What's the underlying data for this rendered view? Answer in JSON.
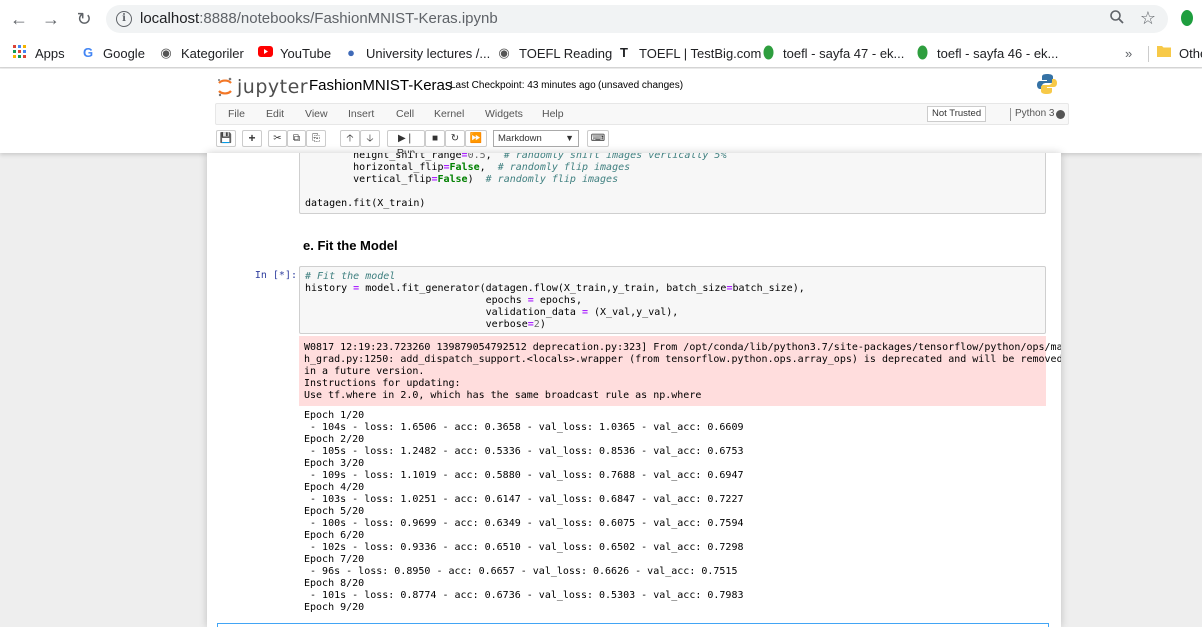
{
  "browser": {
    "url_host": "localhost",
    "url_rest": ":8888/notebooks/FashionMNIST-Keras.ipynb",
    "bookmarks": [
      {
        "label": "Apps",
        "icon": "apps-grid-icon"
      },
      {
        "label": "Google",
        "icon": "google-icon"
      },
      {
        "label": "Kategoriler",
        "icon": "globe-icon"
      },
      {
        "label": "YouTube",
        "icon": "youtube-icon"
      },
      {
        "label": "University lectures /...",
        "icon": "university-icon"
      },
      {
        "label": "TOEFL Reading",
        "icon": "globe-icon"
      },
      {
        "label": "TOEFL | TestBig.com",
        "icon": "t-icon"
      },
      {
        "label": "toefl - sayfa 47 - ek...",
        "icon": "leaf-icon"
      },
      {
        "label": "toefl - sayfa 46 - ek...",
        "icon": "leaf-icon"
      }
    ],
    "bookmarks_more": "»",
    "bookmarks_other": "Othe"
  },
  "jupyter": {
    "logo_text": "jupyter",
    "notebook_name": "FashionMNIST-Keras",
    "checkpoint": "Last Checkpoint: 43 minutes ago",
    "unsaved": "(unsaved changes)",
    "menu": [
      "File",
      "Edit",
      "View",
      "Insert",
      "Cell",
      "Kernel",
      "Widgets",
      "Help"
    ],
    "trust": "Not Trusted",
    "kernel": "Python 3",
    "toolbar": {
      "run_label": "Run",
      "cell_type": "Markdown"
    }
  },
  "cells": {
    "prev_code_lines": [
      "        height_shift_range=0.5,  # randomly shift images vertically 5%",
      "        horizontal_flip=False,  # randomly flip images",
      "        vertical_flip=False)  # randomly flip images"
    ],
    "prev_code_last": "datagen.fit(X_train)",
    "heading": "e. Fit the Model",
    "prompt": "In [*]:",
    "code_lines": [
      "# Fit the model",
      "history = model.fit_generator(datagen.flow(X_train,y_train, batch_size=batch_size),",
      "                              epochs = epochs,",
      "                              validation_data = (X_val,y_val),",
      "                              verbose=2)"
    ],
    "stderr_lines": [
      "W0817 12:19:23.723260 139879054792512 deprecation.py:323] From /opt/conda/lib/python3.7/site-packages/tensorflow/python/ops/mat",
      "h_grad.py:1250: add_dispatch_support.<locals>.wrapper (from tensorflow.python.ops.array_ops) is deprecated and will be removed",
      "in a future version.",
      "Instructions for updating:",
      "Use tf.where in 2.0, which has the same broadcast rule as np.where"
    ],
    "stdout_lines": [
      "Epoch 1/20",
      " - 104s - loss: 1.6506 - acc: 0.3658 - val_loss: 1.0365 - val_acc: 0.6609",
      "Epoch 2/20",
      " - 105s - loss: 1.2482 - acc: 0.5336 - val_loss: 0.8536 - val_acc: 0.6753",
      "Epoch 3/20",
      " - 109s - loss: 1.1019 - acc: 0.5880 - val_loss: 0.7688 - val_acc: 0.6947",
      "Epoch 4/20",
      " - 103s - loss: 1.0251 - acc: 0.6147 - val_loss: 0.6847 - val_acc: 0.7227",
      "Epoch 5/20",
      " - 100s - loss: 0.9699 - acc: 0.6349 - val_loss: 0.6075 - val_acc: 0.7594",
      "Epoch 6/20",
      " - 102s - loss: 0.9336 - acc: 0.6510 - val_loss: 0.6502 - val_acc: 0.7298",
      "Epoch 7/20",
      " - 96s - loss: 0.8950 - acc: 0.6657 - val_loss: 0.6626 - val_acc: 0.7515",
      "Epoch 8/20",
      " - 101s - loss: 0.8774 - acc: 0.6736 - val_loss: 0.5303 - val_acc: 0.7983",
      "Epoch 9/20"
    ]
  }
}
